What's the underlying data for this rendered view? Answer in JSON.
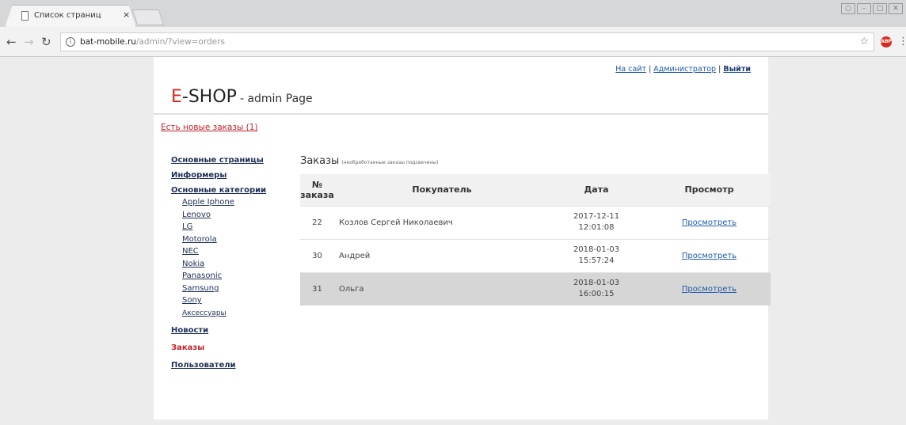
{
  "browser": {
    "tab_title": "Список страниц",
    "tab_close": "×",
    "url_host": "bat-mobile.ru",
    "url_path": "/admin/?view=orders",
    "ext_label": "ABP"
  },
  "header": {
    "logo_e": "E",
    "logo_shop": "-SHOP",
    "logo_sub": "- admin Page",
    "links": {
      "site": "На сайт",
      "admin": "Администратор",
      "logout": "Выйти",
      "sep": "|"
    }
  },
  "alert": "Есть новые заказы (1)",
  "sidebar": {
    "main_pages": "Основные страницы",
    "informers": "Информеры",
    "categories": "Основные категории",
    "subcategories": [
      "Apple Iphone",
      "Lenovo",
      "LG",
      "Motorola",
      "NEC",
      "Nokia",
      "Panasonic",
      "Samsung",
      "Sony",
      "Аксессуары"
    ],
    "news": "Новости",
    "orders": "Заказы",
    "users": "Пользователи"
  },
  "content": {
    "title": "Заказы",
    "note": "(необработанные заказы подсвечены)",
    "columns": {
      "id_line1": "№",
      "id_line2": "заказа",
      "buyer": "Покупатель",
      "date": "Дата",
      "view": "Просмотр"
    },
    "rows": [
      {
        "id": "22",
        "buyer": "Козлов Сергей Николаевич",
        "date": "2017-12-11",
        "time": "12:01:08",
        "link": "Просмотреть"
      },
      {
        "id": "30",
        "buyer": "Андрей",
        "date": "2018-01-03",
        "time": "15:57:24",
        "link": "Просмотреть"
      },
      {
        "id": "31",
        "buyer": "Ольга",
        "date": "2018-01-03",
        "time": "16:00:15",
        "link": "Просмотреть"
      }
    ]
  }
}
